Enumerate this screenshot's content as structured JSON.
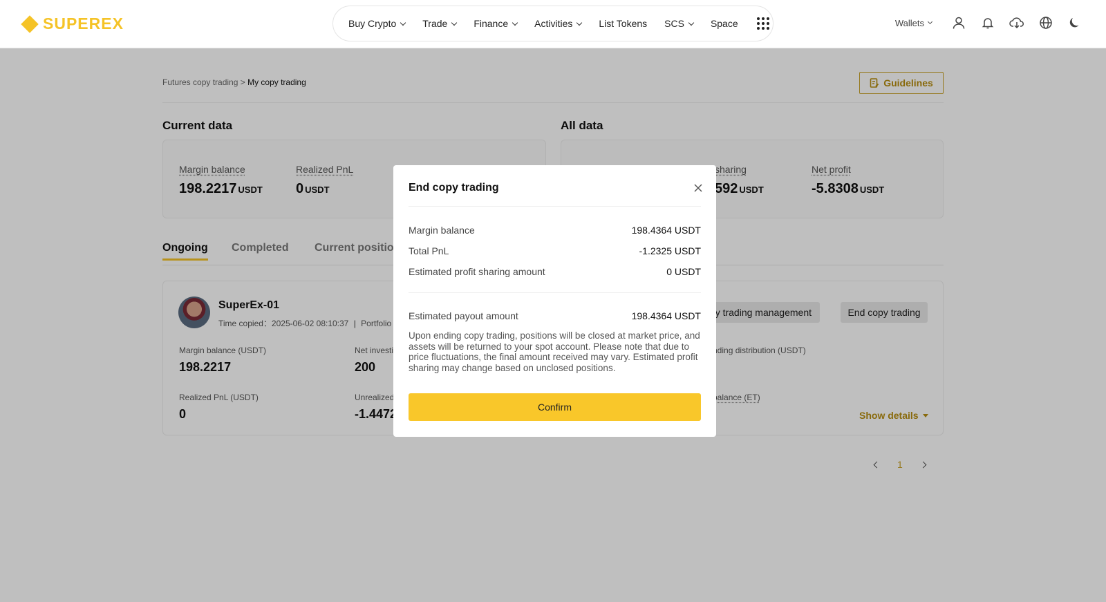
{
  "header": {
    "logo": "SUPEREX",
    "nav": [
      {
        "label": "Buy Crypto",
        "dropdown": true
      },
      {
        "label": "Trade",
        "dropdown": true
      },
      {
        "label": "Finance",
        "dropdown": true
      },
      {
        "label": "Activities",
        "dropdown": true
      },
      {
        "label": "List Tokens",
        "dropdown": false
      },
      {
        "label": "SCS",
        "dropdown": true
      },
      {
        "label": "Space",
        "dropdown": false
      }
    ],
    "wallets_label": "Wallets",
    "icons": [
      "user-icon",
      "bell-icon",
      "download-icon",
      "globe-icon",
      "moon-icon"
    ]
  },
  "breadcrumb": {
    "parent": "Futures copy trading",
    "separator": " > ",
    "current": "My copy trading"
  },
  "guidelines_label": "Guidelines",
  "current_data": {
    "title": "Current data",
    "margin_balance_label": "Margin balance",
    "margin_balance_value": "198.2217",
    "realized_pnl_label": "Realized PnL",
    "realized_pnl_value": "0",
    "unit": "USDT"
  },
  "all_data": {
    "title": "All data",
    "profit_sharing_label": "sharing",
    "profit_sharing_value": "592",
    "net_profit_label": "Net profit",
    "net_profit_value": "-5.8308",
    "unit": "USDT"
  },
  "tabs": [
    "Ongoing",
    "Completed",
    "Current positio"
  ],
  "trader": {
    "name": "SuperEx-01",
    "time_copied_label": "Time copied：",
    "time_copied_value": "2025-06-02 08:10:37",
    "portfolio_label": "Portfolio II",
    "mgmt_button": "opy trading management",
    "end_button": "End copy trading",
    "margin_balance_label": "Margin balance (USDT)",
    "margin_balance_value": "198.2217",
    "net_invest_label": "Net investi",
    "net_invest_value": "200",
    "pending_label": "nding distribution (USDT)",
    "realized_label": "Realized PnL (USDT)",
    "realized_value": "0",
    "unrealized_label": "Unrealized",
    "unrealized_value": "-1.4472",
    "balance_et_label": "balance (ET)",
    "show_details": "Show details"
  },
  "pagination": {
    "current": "1"
  },
  "modal": {
    "title": "End copy trading",
    "rows": [
      {
        "label": "Margin balance",
        "value": "198.4364 USDT"
      },
      {
        "label": "Total PnL",
        "value": "-1.2325 USDT"
      },
      {
        "label": "Estimated profit sharing amount",
        "value": "0 USDT"
      }
    ],
    "payout_label": "Estimated payout amount",
    "payout_value": "198.4364 USDT",
    "note": "Upon ending copy trading, positions will be closed at market price, and assets will be returned to your spot account. Please note that due to price fluctuations, the final amount received may vary. Estimated profit sharing may change based on unclosed positions.",
    "confirm_label": "Confirm"
  }
}
